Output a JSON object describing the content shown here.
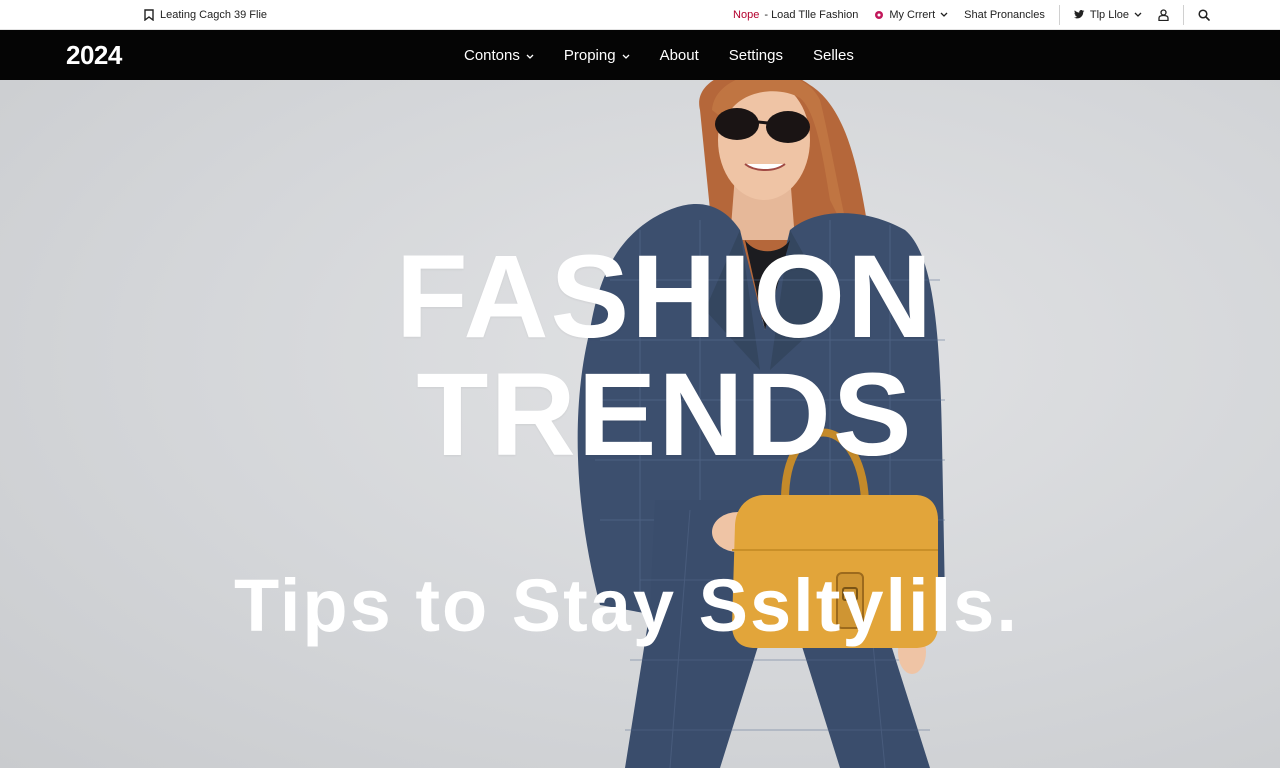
{
  "utility_bar": {
    "left_icon": "bookmark-icon",
    "left_text": "Leating Cagch 39 Flie",
    "promo_highlight": "Nope",
    "promo_text": "- Load Tlle Fashion",
    "cart_label": "My Crrert",
    "shop_label": "Shat Pronancles",
    "social_label": "Tlp Lloe",
    "colors": {
      "highlight": "#b3002d",
      "cart_dot": "#c2185b"
    }
  },
  "nav": {
    "brand": "2024",
    "items": [
      {
        "label": "Contons",
        "has_dropdown": true
      },
      {
        "label": "Proping",
        "has_dropdown": true
      },
      {
        "label": "About",
        "has_dropdown": false
      },
      {
        "label": "Settings",
        "has_dropdown": false
      },
      {
        "label": "Selles",
        "has_dropdown": false
      }
    ]
  },
  "hero": {
    "title_line1": "FASHION",
    "title_line2": "TRENDS",
    "subtitle": "Tips to Stay Ssltylils."
  }
}
